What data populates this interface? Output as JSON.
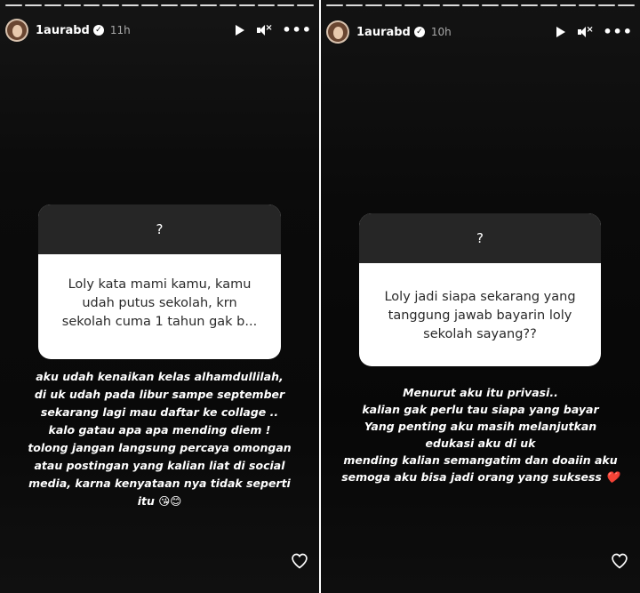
{
  "stories": [
    {
      "username": "1aurabd",
      "time": "11h",
      "question_mark": "?",
      "question_lines": [
        "Loly kata mami kamu, kamu",
        "udah putus sekolah, krn",
        "sekolah cuma 1 tahun gak b..."
      ],
      "answer_lines": [
        "aku udah kenaikan kelas alhamdullilah,",
        "di uk udah pada libur sampe september",
        "sekarang lagi mau daftar ke collage ..",
        "kalo gatau apa apa mending diem !",
        "tolong jangan langsung percaya omongan",
        "atau postingan yang kalian liat di social",
        "media, karna kenyataan nya tidak seperti",
        "itu 😘😊"
      ]
    },
    {
      "username": "1aurabd",
      "time": "10h",
      "question_mark": "?",
      "question_lines": [
        "Loly jadi siapa sekarang yang",
        "tanggung jawab bayarin loly",
        "sekolah sayang??"
      ],
      "answer_lines": [
        "Menurut aku itu privasi..",
        "kalian gak perlu tau siapa yang bayar",
        "Yang penting aku masih melanjutkan",
        "edukasi aku di uk",
        "mending kalian semangatim dan doaiin aku",
        "semoga aku bisa jadi orang yang suksess ❤️"
      ]
    }
  ]
}
